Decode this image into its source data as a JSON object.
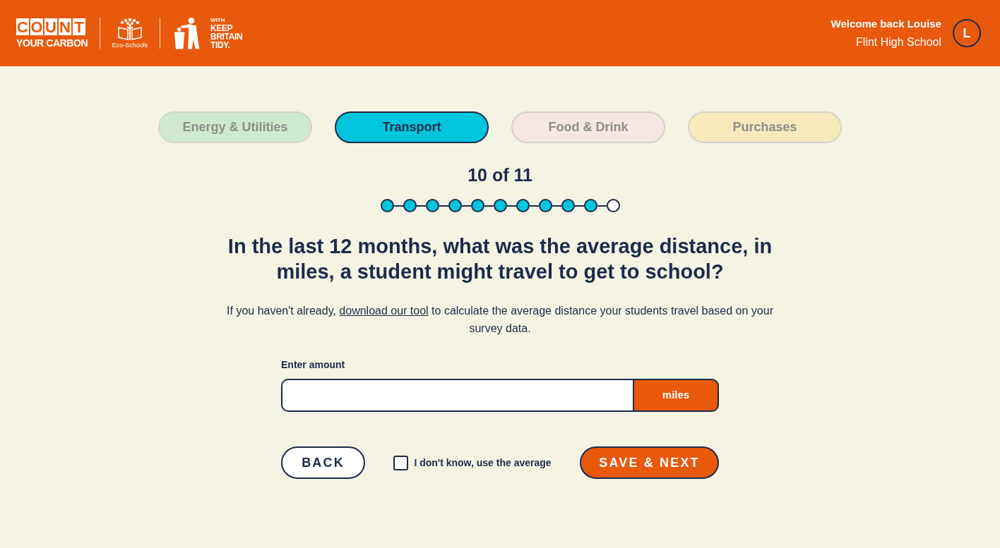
{
  "header": {
    "logos": {
      "count_your_carbon": {
        "top": "COUNT",
        "bottom": "YOUR CARBON"
      },
      "eco_schools": {
        "label": "Eco-Schools"
      },
      "keep_britain_tidy": {
        "prefix": "WITH",
        "lines": [
          "KEEP",
          "BRITAIN",
          "TIDY."
        ]
      }
    },
    "user": {
      "greeting": "Welcome back Louise",
      "school": "Flint High School",
      "initial": "L"
    }
  },
  "tabs": [
    {
      "label": "Energy & Utilities",
      "selected": false,
      "color": "#cfe9d1"
    },
    {
      "label": "Transport",
      "selected": true,
      "color": "#00c5dd"
    },
    {
      "label": "Food & Drink",
      "selected": false,
      "color": "#f5e7e3"
    },
    {
      "label": "Purchases",
      "selected": false,
      "color": "#f6eabd"
    }
  ],
  "progress": {
    "label": "10 of 11",
    "steps": [
      {
        "done": true
      },
      {
        "done": true
      },
      {
        "done": true
      },
      {
        "done": true
      },
      {
        "done": true
      },
      {
        "done": true
      },
      {
        "done": true
      },
      {
        "done": true
      },
      {
        "done": true
      },
      {
        "done": true
      },
      {
        "done": false
      }
    ]
  },
  "question": {
    "title": "In the last 12 months, what was the average distance, in miles, a student might travel to get to school?",
    "hint": {
      "before": "If you haven't already, ",
      "link": "download our tool",
      "after": " to calculate the average distance your students travel based on your survey data."
    }
  },
  "field": {
    "label": "Enter amount",
    "unit": "miles"
  },
  "dont_know": {
    "label": "I don't know, use the average",
    "checked": false
  },
  "buttons": {
    "back": "BACK",
    "next": "SAVE & NEXT"
  }
}
